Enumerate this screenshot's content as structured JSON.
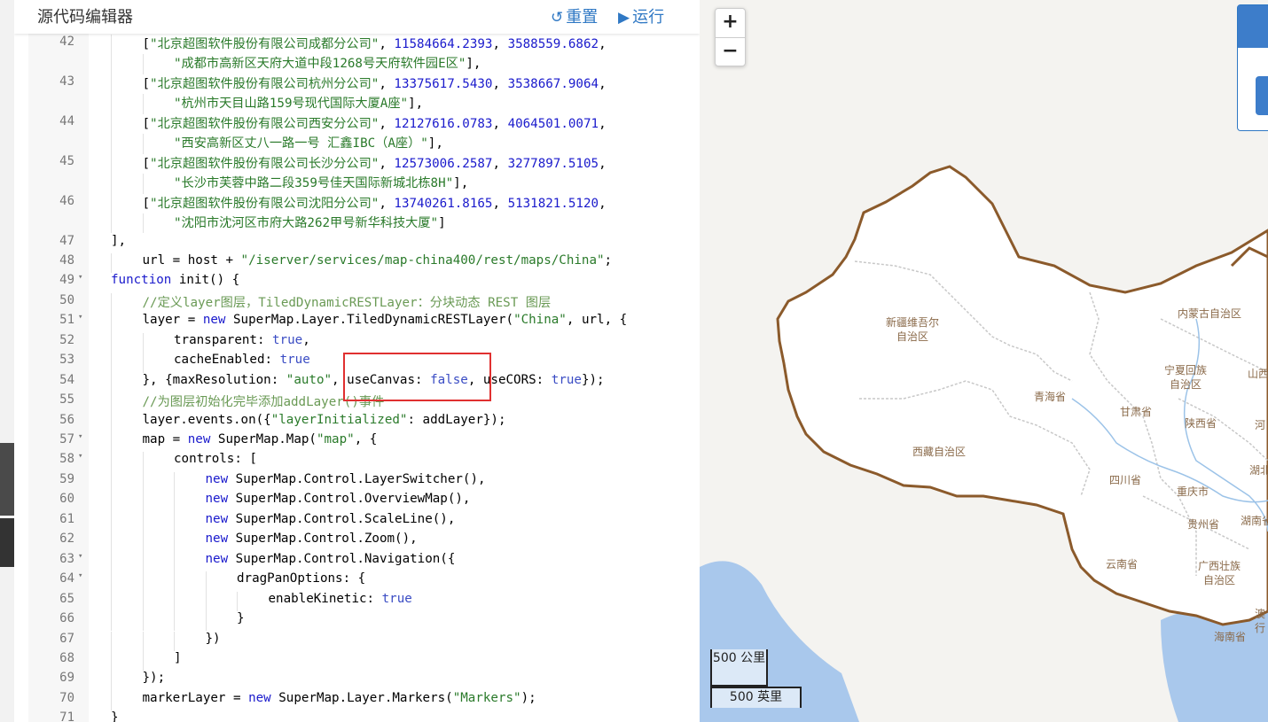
{
  "editor": {
    "title": "源代码编辑器",
    "reset_label": "重置",
    "run_label": "运行"
  },
  "code_lines": [
    {
      "n": "42",
      "indent": 1,
      "tokens": [
        [
          "p",
          "["
        ],
        [
          "s",
          "\"北京超图软件股份有限公司成都分公司\""
        ],
        [
          "p",
          ", "
        ],
        [
          "n",
          "11584664.2393"
        ],
        [
          "p",
          ", "
        ],
        [
          "n",
          "3588559.6862"
        ],
        [
          "p",
          ","
        ]
      ]
    },
    {
      "n": "",
      "indent": 2,
      "tokens": [
        [
          "s",
          "\"成都市高新区天府大道中段1268号天府软件园E区\""
        ],
        [
          "p",
          "],"
        ]
      ]
    },
    {
      "n": "43",
      "indent": 1,
      "tokens": [
        [
          "p",
          "["
        ],
        [
          "s",
          "\"北京超图软件股份有限公司杭州分公司\""
        ],
        [
          "p",
          ", "
        ],
        [
          "n",
          "13375617.5430"
        ],
        [
          "p",
          ", "
        ],
        [
          "n",
          "3538667.9064"
        ],
        [
          "p",
          ","
        ]
      ]
    },
    {
      "n": "",
      "indent": 2,
      "tokens": [
        [
          "s",
          "\"杭州市天目山路159号现代国际大厦A座\""
        ],
        [
          "p",
          "],"
        ]
      ]
    },
    {
      "n": "44",
      "indent": 1,
      "tokens": [
        [
          "p",
          "["
        ],
        [
          "s",
          "\"北京超图软件股份有限公司西安分公司\""
        ],
        [
          "p",
          ", "
        ],
        [
          "n",
          "12127616.0783"
        ],
        [
          "p",
          ", "
        ],
        [
          "n",
          "4064501.0071"
        ],
        [
          "p",
          ","
        ]
      ]
    },
    {
      "n": "",
      "indent": 2,
      "tokens": [
        [
          "s",
          "\"西安高新区丈八一路一号 汇鑫IBC（A座）\""
        ],
        [
          "p",
          "],"
        ]
      ]
    },
    {
      "n": "45",
      "indent": 1,
      "tokens": [
        [
          "p",
          "["
        ],
        [
          "s",
          "\"北京超图软件股份有限公司长沙分公司\""
        ],
        [
          "p",
          ", "
        ],
        [
          "n",
          "12573006.2587"
        ],
        [
          "p",
          ", "
        ],
        [
          "n",
          "3277897.5105"
        ],
        [
          "p",
          ","
        ]
      ]
    },
    {
      "n": "",
      "indent": 2,
      "tokens": [
        [
          "s",
          "\"长沙市芙蓉中路二段359号佳天国际新城北栋8H\""
        ],
        [
          "p",
          "],"
        ]
      ]
    },
    {
      "n": "46",
      "indent": 1,
      "tokens": [
        [
          "p",
          "["
        ],
        [
          "s",
          "\"北京超图软件股份有限公司沈阳分公司\""
        ],
        [
          "p",
          ", "
        ],
        [
          "n",
          "13740261.8165"
        ],
        [
          "p",
          ", "
        ],
        [
          "n",
          "5131821.5120"
        ],
        [
          "p",
          ","
        ]
      ]
    },
    {
      "n": "",
      "indent": 2,
      "tokens": [
        [
          "s",
          "\"沈阳市沈河区市府大路262甲号新华科技大厦\""
        ],
        [
          "p",
          "]"
        ]
      ]
    },
    {
      "n": "47",
      "indent": 0,
      "tokens": [
        [
          "p",
          "],"
        ]
      ]
    },
    {
      "n": "48",
      "indent": 1,
      "tokens": [
        [
          "p",
          "url = host + "
        ],
        [
          "s",
          "\"/iserver/services/map-china400/rest/maps/China\""
        ],
        [
          "p",
          ";"
        ]
      ]
    },
    {
      "n": "49",
      "fold": true,
      "indent": 0,
      "tokens": [
        [
          "k",
          "function"
        ],
        [
          "p",
          " init() {"
        ]
      ]
    },
    {
      "n": "50",
      "indent": 1,
      "tokens": [
        [
          "c",
          "//定义layer图层，TiledDynamicRESTLayer：分块动态 REST 图层"
        ]
      ]
    },
    {
      "n": "51",
      "fold": true,
      "indent": 1,
      "tokens": [
        [
          "p",
          "layer = "
        ],
        [
          "k",
          "new"
        ],
        [
          "p",
          " SuperMap.Layer.TiledDynamicRESTLayer("
        ],
        [
          "s",
          "\"China\""
        ],
        [
          "p",
          ", url, {"
        ]
      ]
    },
    {
      "n": "52",
      "indent": 2,
      "tokens": [
        [
          "p",
          "transparent: "
        ],
        [
          "b",
          "true"
        ],
        [
          "p",
          ","
        ]
      ]
    },
    {
      "n": "53",
      "indent": 2,
      "tokens": [
        [
          "p",
          "cacheEnabled: "
        ],
        [
          "b",
          "true"
        ]
      ]
    },
    {
      "n": "54",
      "indent": 1,
      "tokens": [
        [
          "p",
          "}, {maxResolution: "
        ],
        [
          "s",
          "\"auto\""
        ],
        [
          "p",
          ", useCanvas: "
        ],
        [
          "b",
          "false"
        ],
        [
          "p",
          ", useCORS: "
        ],
        [
          "b",
          "true"
        ],
        [
          "p",
          "});"
        ]
      ]
    },
    {
      "n": "55",
      "indent": 1,
      "tokens": [
        [
          "c",
          "//为图层初始化完毕添加addLayer()事件"
        ]
      ]
    },
    {
      "n": "56",
      "indent": 1,
      "tokens": [
        [
          "p",
          "layer.events.on({"
        ],
        [
          "s",
          "\"layerInitialized\""
        ],
        [
          "p",
          ": addLayer});"
        ]
      ]
    },
    {
      "n": "57",
      "fold": true,
      "indent": 1,
      "tokens": [
        [
          "p",
          "map = "
        ],
        [
          "k",
          "new"
        ],
        [
          "p",
          " SuperMap.Map("
        ],
        [
          "s",
          "\"map\""
        ],
        [
          "p",
          ", {"
        ]
      ]
    },
    {
      "n": "58",
      "fold": true,
      "indent": 2,
      "tokens": [
        [
          "p",
          "controls: ["
        ]
      ]
    },
    {
      "n": "59",
      "indent": 3,
      "tokens": [
        [
          "k",
          "new"
        ],
        [
          "p",
          " SuperMap.Control.LayerSwitcher(),"
        ]
      ]
    },
    {
      "n": "60",
      "indent": 3,
      "tokens": [
        [
          "k",
          "new"
        ],
        [
          "p",
          " SuperMap.Control.OverviewMap(),"
        ]
      ]
    },
    {
      "n": "61",
      "indent": 3,
      "tokens": [
        [
          "k",
          "new"
        ],
        [
          "p",
          " SuperMap.Control.ScaleLine(),"
        ]
      ]
    },
    {
      "n": "62",
      "indent": 3,
      "tokens": [
        [
          "k",
          "new"
        ],
        [
          "p",
          " SuperMap.Control.Zoom(),"
        ]
      ]
    },
    {
      "n": "63",
      "fold": true,
      "indent": 3,
      "tokens": [
        [
          "k",
          "new"
        ],
        [
          "p",
          " SuperMap.Control.Navigation({"
        ]
      ]
    },
    {
      "n": "64",
      "fold": true,
      "indent": 4,
      "tokens": [
        [
          "p",
          "dragPanOptions: {"
        ]
      ]
    },
    {
      "n": "65",
      "indent": 5,
      "tokens": [
        [
          "p",
          "enableKinetic: "
        ],
        [
          "b",
          "true"
        ]
      ]
    },
    {
      "n": "66",
      "indent": 4,
      "tokens": [
        [
          "p",
          "}"
        ]
      ]
    },
    {
      "n": "67",
      "indent": 3,
      "tokens": [
        [
          "p",
          "})"
        ]
      ]
    },
    {
      "n": "68",
      "indent": 2,
      "tokens": [
        [
          "p",
          "]"
        ]
      ]
    },
    {
      "n": "69",
      "indent": 1,
      "tokens": [
        [
          "p",
          "});"
        ]
      ]
    },
    {
      "n": "70",
      "indent": 1,
      "tokens": [
        [
          "p",
          "markerLayer = "
        ],
        [
          "k",
          "new"
        ],
        [
          "p",
          " SuperMap.Layer.Markers("
        ],
        [
          "s",
          "\"Markers\""
        ],
        [
          "p",
          ");"
        ]
      ]
    },
    {
      "n": "71",
      "indent": 0,
      "tokens": [
        [
          "p",
          "}"
        ]
      ]
    }
  ],
  "map": {
    "zoom_in": "+",
    "zoom_out": "−",
    "scale_km": "500 公里",
    "scale_mi": "500 英里",
    "regions": [
      {
        "id": "xinjiang",
        "name": "新疆维吾尔\n自治区"
      },
      {
        "id": "xizang",
        "name": "西藏自治区"
      },
      {
        "id": "qinghai",
        "name": "青海省"
      },
      {
        "id": "gansu",
        "name": "甘肃省"
      },
      {
        "id": "ningxia",
        "name": "宁夏回族\n自治区"
      },
      {
        "id": "neimenggu",
        "name": "内蒙古自治区"
      },
      {
        "id": "shaanxi",
        "name": "陕西省"
      },
      {
        "id": "sichuan",
        "name": "四川省"
      },
      {
        "id": "chongqing",
        "name": "重庆市"
      },
      {
        "id": "guizhou",
        "name": "贵州省"
      },
      {
        "id": "yunnan",
        "name": "云南省"
      },
      {
        "id": "guangxi",
        "name": "广西壮族\n自治区"
      },
      {
        "id": "hunan",
        "name": "湖南省"
      },
      {
        "id": "hainan",
        "name": "海南省"
      },
      {
        "id": "shanxi",
        "name": "山西"
      },
      {
        "id": "hubei",
        "name": "湖北"
      },
      {
        "id": "henan",
        "name": "河"
      },
      {
        "id": "macao",
        "name": "澳\n行"
      }
    ],
    "colors": {
      "land": "#ffffff",
      "sea": "#a9c8ec",
      "border": "#8b5a2b",
      "bg": "#f4f3f0"
    }
  }
}
